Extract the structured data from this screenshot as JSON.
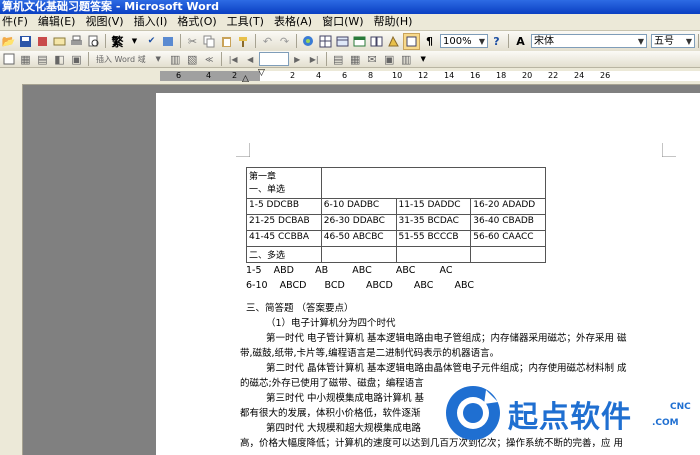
{
  "window": {
    "title": "算机文化基础习题答案 - Microsoft Word"
  },
  "menu": [
    "件(F)",
    "编辑(E)",
    "视图(V)",
    "插入(I)",
    "格式(O)",
    "工具(T)",
    "表格(A)",
    "窗口(W)",
    "帮助(H)"
  ],
  "toolbar": {
    "traditional": "繁",
    "zoom": "100%",
    "font": "宋体",
    "size": "五号",
    "bold": "B",
    "italic": "I",
    "underline": "U",
    "insert_word_label": "插入 Word 域"
  },
  "ruler": {
    "left_numbers": [
      "6",
      "4",
      "2"
    ],
    "right_numbers": [
      "2",
      "4",
      "6",
      "8",
      "10",
      "12",
      "14",
      "16",
      "18",
      "20",
      "22",
      "24",
      "26"
    ]
  },
  "document": {
    "table_row1_col1_line1": "第一章",
    "table_row1_col1_line2": "一、单选",
    "table_rows": [
      [
        "1-5 DDCBB",
        "6-10 DADBC",
        "11-15 DADDC",
        "16-20 ADADD"
      ],
      [
        "21-25 DCBAB",
        "26-30 DDABC",
        "31-35 BCDAC",
        "36-40 CBADB"
      ],
      [
        "41-45 CCBBA",
        "46-50 ABCBC",
        "51-55 BCCCB",
        "56-60 CAACC"
      ]
    ],
    "table_last_row": "二、多选",
    "multi_line1": "1-5    ABD       AB        ABC        ABC        AC",
    "multi_line2": "6-10    ABCD      BCD       ABCD       ABC       ABC",
    "section3": "三、简答题    （答案要点）",
    "q1": "（1）电子计算机分为四个时代",
    "p1a": "第一时代  电子管计算机  基本逻辑电路由电子管组成；内存储器采用磁芯；外存采用  磁",
    "p1b": "带,磁鼓,纸带,卡片等,编程语言是二进制代码表示的机器语言。",
    "p2a": "第二时代  晶体管计算机  基本逻辑电路由晶体管电子元件组成；内存使用磁芯材料制  成",
    "p2b": "的磁芯;外存已使用了磁带、磁盘；编程语言",
    "p3a": "第三时代  中小规模集成电路计算机  基",
    "p3b": "都有很大的发展，体积小价格低，软件逐渐",
    "p4a": "第四时代  大规模和超大规模集成电路",
    "p4b": "高，价格大幅度降低；计算机的速度可以达到几百万次到亿次；操作系统不断的完善，应  用"
  },
  "watermark": {
    "text": "起点软件",
    "sub1": "CNC",
    "sub2": ".COM",
    "color": "#1f6fd1"
  }
}
